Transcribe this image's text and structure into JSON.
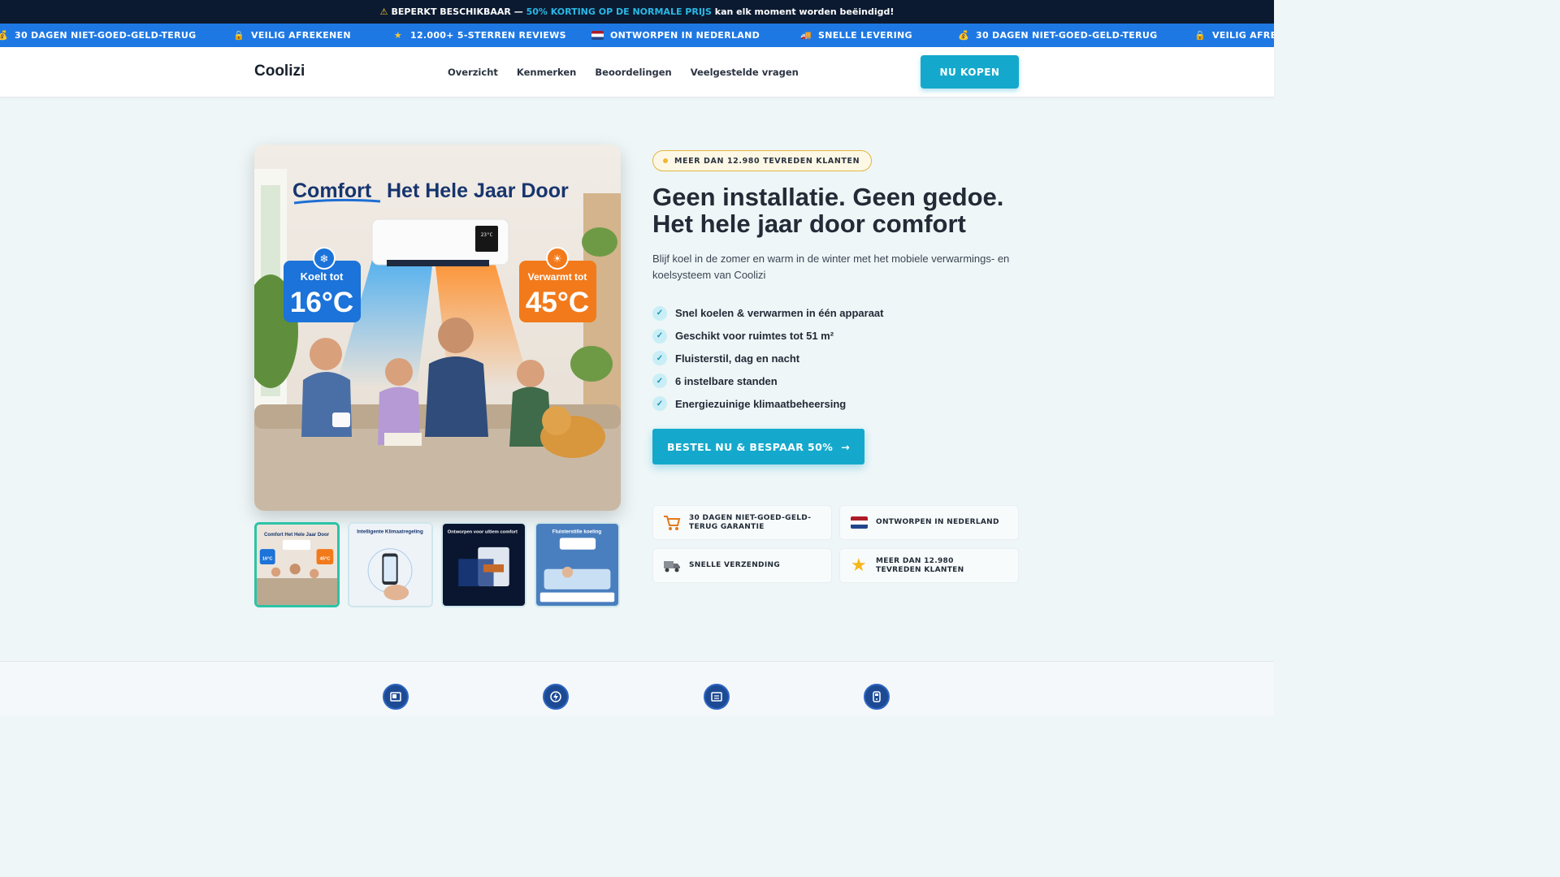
{
  "announcement": {
    "prefix": "BEPERKT BESCHIKBAAR —",
    "highlight": "50% KORTING OP DE NORMALE PRIJS",
    "suffix": "kan elk moment worden beëindigd!",
    "icon": "warning-icon"
  },
  "ticker": {
    "items": [
      {
        "label": "30 DAGEN NIET-GOED-GELD-TERUG",
        "icon": "money-bag-icon"
      },
      {
        "label": "VEILIG AFREKENEN",
        "icon": "lock-icon"
      },
      {
        "label": "12.000+ 5-STERREN REVIEWS",
        "icon": "star-icon"
      },
      {
        "label": "ONTWORPEN IN NEDERLAND",
        "icon": "dutch-flag-icon"
      },
      {
        "label": "SNELLE LEVERING",
        "icon": "truck-icon"
      },
      {
        "label": "30 DAGEN NIET-GOED-GELD-TERUG",
        "icon": "money-bag-icon"
      },
      {
        "label": "VEILIG AFREKENEN",
        "icon": "lock-icon"
      }
    ]
  },
  "nav": {
    "logo": "Coolizi",
    "links": [
      "Overzicht",
      "Kenmerken",
      "Beoordelingen",
      "Veelgestelde vragen"
    ],
    "buy_label": "NU KOPEN"
  },
  "hero_image": {
    "title_word": "Comfort",
    "title_rest": "Het Hele Jaar Door",
    "cool_label": "Koelt tot",
    "cool_temp": "16°C",
    "heat_label": "Verwarmt tot",
    "heat_temp": "45°C",
    "display": "23°C"
  },
  "thumbnails": [
    {
      "caption": "Comfort Het Hele Jaar Door",
      "cool": "16°C",
      "heat": "45°C"
    },
    {
      "caption": "Intelligente Klimaatregeling"
    },
    {
      "caption": "Ontworpen voor ultiem comfort"
    },
    {
      "caption": "Fluisterstille koeling"
    }
  ],
  "badge": "MEER DAN 12.980 TEVREDEN KLANTEN",
  "headline": {
    "line1": "Geen installatie. Geen gedoe.",
    "line2": "Het hele jaar door comfort"
  },
  "subtext": "Blijf koel in de zomer en warm in de winter met het mobiele verwarmings- en koelsysteem van Coolizi",
  "features": [
    "Snel koelen & verwarmen in één apparaat",
    "Geschikt voor ruimtes tot 51 m²",
    "Fluisterstil, dag en nacht",
    "6 instelbare standen",
    "Energiezuinige klimaatbeheersing"
  ],
  "cta": {
    "label": "BESTEL NU & BESPAAR 50%",
    "arrow": "→"
  },
  "trust": [
    {
      "label": "30 DAGEN NIET-GOED-GELD-TERUG GARANTIE",
      "icon": "cart-icon"
    },
    {
      "label": "ONTWORPEN IN NEDERLAND",
      "icon": "dutch-flag-icon"
    },
    {
      "label": "SNELLE VERZENDING",
      "icon": "truck-icon"
    },
    {
      "label": "MEER DAN 12.980 TEVREDEN KLANTEN",
      "icon": "star-icon"
    }
  ],
  "colors": {
    "accent": "#14a9cc",
    "topbar": "#0b1a30",
    "ticker": "#1e78e3",
    "check": "#c9eef6",
    "badge_border": "#e3b53d"
  }
}
